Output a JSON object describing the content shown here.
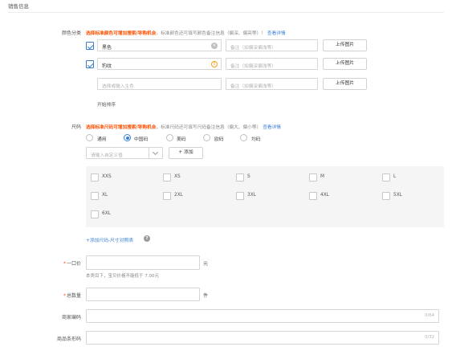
{
  "section": {
    "title": "销售信息"
  },
  "color": {
    "label": "颜色分类",
    "hint_em": "选择标准颜色可增加搜索/导购机会",
    "hint_rest": "，标准颜色还可填写颜色备注信息（偏深、偏亮等）！",
    "hint_link": "查看详情",
    "rows": [
      {
        "checked": true,
        "value": "黑色",
        "icon": "clear-icon",
        "note_placeholder": "备注（如偏深偏浅等）",
        "button": "上传图片"
      },
      {
        "checked": true,
        "value": "豹纹",
        "icon": "warning-icon",
        "note_placeholder": "备注（如偏深偏浅等）",
        "button": "上传图片"
      },
      {
        "checked": false,
        "placeholder": "选择或输入主色",
        "note_placeholder": "备注（如偏深偏浅等）",
        "button": "上传图片"
      }
    ],
    "sort_label": "开始排序"
  },
  "size": {
    "label": "尺码",
    "hint_em": "选择标准尺码可增加搜索/导购机会",
    "hint_rest": "，标准尺码还可填写尺码备注信息（偏大、偏小等）",
    "hint_link": "查看详情",
    "types": [
      {
        "label": "通用",
        "selected": false
      },
      {
        "label": "中国码",
        "selected": true
      },
      {
        "label": "美码",
        "selected": false
      },
      {
        "label": "欧码",
        "selected": false
      },
      {
        "label": "均码",
        "selected": false
      }
    ],
    "custom_placeholder": "请输入自定义值",
    "add_button": "+ 添加",
    "options": [
      "XXS",
      "XS",
      "S",
      "M",
      "L",
      "XL",
      "2XL",
      "3XL",
      "4XL",
      "5XL",
      "6XL"
    ],
    "add_chart_link": "+添加尺码-尺寸对照表"
  },
  "price": {
    "label": "一口价",
    "required": "*",
    "unit": "元",
    "note": "本类目下，宝贝价格不能低于 7.00元"
  },
  "stock": {
    "label": "总数量",
    "required": "*",
    "unit": "件"
  },
  "merchant_code": {
    "label": "商家编码",
    "counter": "0/64"
  },
  "barcode": {
    "label": "商品条形码",
    "counter": "0/32"
  },
  "colors": {
    "accent": "#3a7fd6",
    "emphasis": "#ff5000"
  }
}
